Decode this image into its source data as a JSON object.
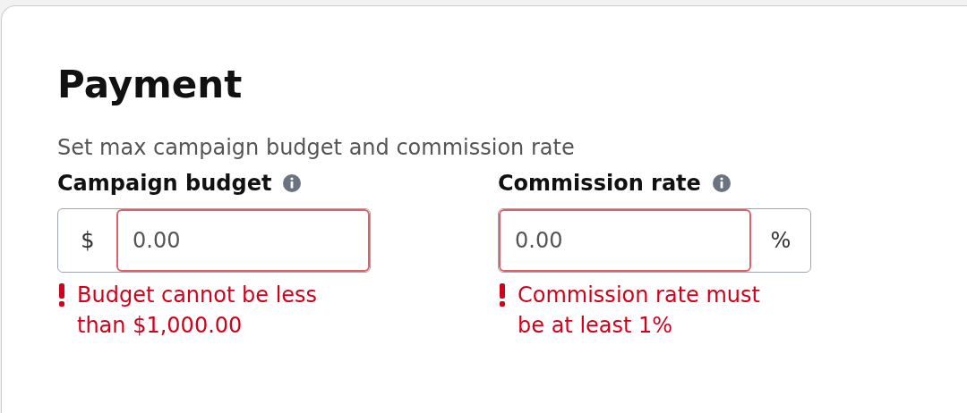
{
  "title": "Payment",
  "subtitle": "Set max campaign budget and commission rate",
  "fields": [
    {
      "label": "Campaign budget",
      "kind": "prefix",
      "affix": "$",
      "placeholder": "0.00",
      "invalid": true,
      "error": "Budget cannot be less than $1,000.00"
    },
    {
      "label": "Commission rate",
      "kind": "suffix",
      "affix": "%",
      "placeholder": "0.00",
      "invalid": true,
      "error": "Commission rate must be at least 1%"
    }
  ]
}
